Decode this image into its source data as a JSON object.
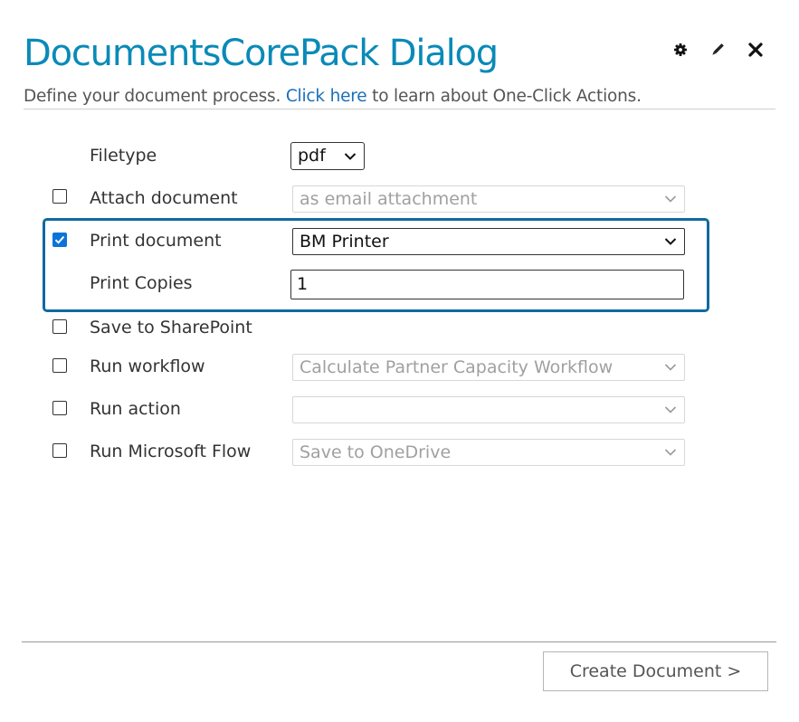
{
  "header": {
    "title": "DocumentsCorePack Dialog",
    "subtitle_before": "Define your document process. ",
    "subtitle_link": "Click here",
    "subtitle_after": " to learn about One-Click Actions.",
    "icons": [
      "gear-icon",
      "pencil-icon",
      "close-icon"
    ]
  },
  "form": {
    "filetype": {
      "label": "Filetype",
      "value": "pdf"
    },
    "attach_document": {
      "label": "Attach document",
      "checked": false,
      "value": "as email attachment"
    },
    "print_document": {
      "label": "Print document",
      "checked": true,
      "value": "BM Printer"
    },
    "print_copies": {
      "label": "Print Copies",
      "value": "1"
    },
    "save_to_sharepoint": {
      "label": "Save to SharePoint",
      "checked": false
    },
    "run_workflow": {
      "label": "Run workflow",
      "checked": false,
      "value": "Calculate Partner Capacity Workflow"
    },
    "run_action": {
      "label": "Run action",
      "checked": false,
      "value": ""
    },
    "run_microsoft_flow": {
      "label": "Run Microsoft Flow",
      "checked": false,
      "value": "Save to OneDrive"
    }
  },
  "footer": {
    "create_button_label": "Create Document >"
  },
  "colors": {
    "title": "#0a8ab8",
    "link": "#1a6fb8",
    "highlight_border": "#0f6aa0",
    "checkbox_checked": "#0b74d8"
  }
}
